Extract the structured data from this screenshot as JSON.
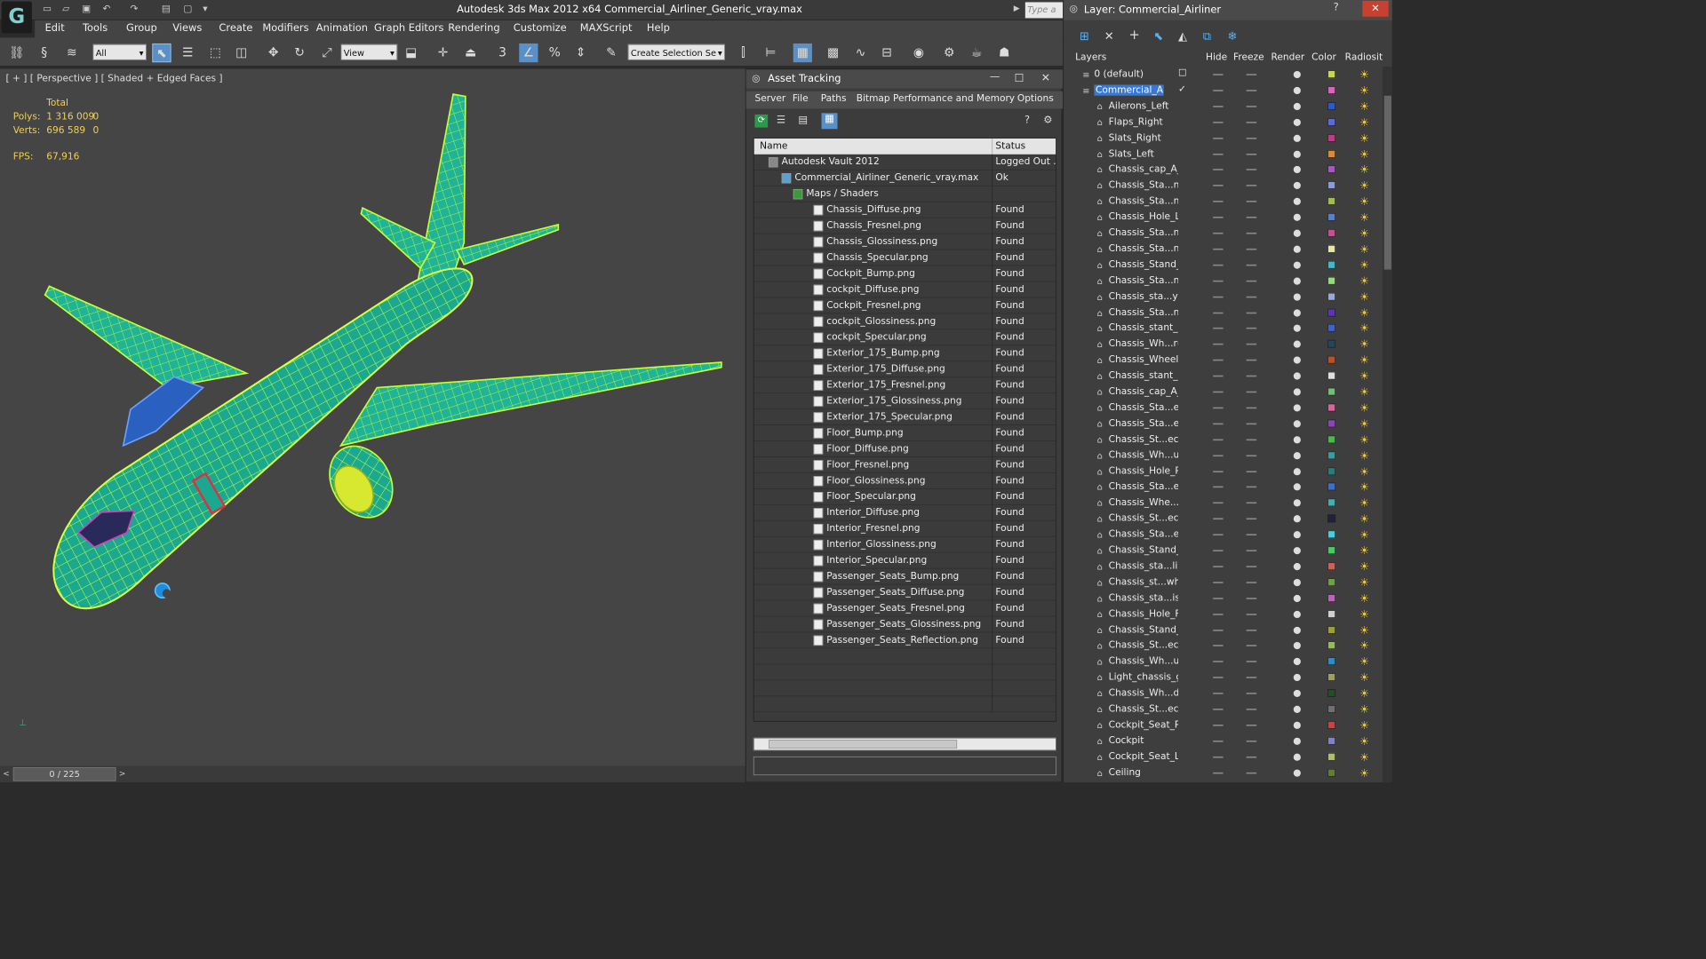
{
  "window": {
    "title": "Autodesk 3ds Max  2012 x64     Commercial_Airliner_Generic_vray.max",
    "search_placeholder": "Type a"
  },
  "menubar": [
    "Edit",
    "Tools",
    "Group",
    "Views",
    "Create",
    "Modifiers",
    "Animation",
    "Graph Editors",
    "Rendering",
    "Customize",
    "MAXScript",
    "Help"
  ],
  "toolbar": {
    "filter_value": "All",
    "refcoord_value": "View",
    "selection_set_placeholder": "Create Selection Se"
  },
  "viewport": {
    "label": "[ + ] [ Perspective ] [ Shaded + Edged Faces ]",
    "stats_header": "Total",
    "polys_label": "Polys:",
    "polys_value": "1 316 009",
    "polys_sel": "0",
    "verts_label": "Verts:",
    "verts_value": "696 589",
    "verts_sel": "0",
    "fps_label": "FPS:",
    "fps_value": "67,916"
  },
  "timeline": {
    "frame": "0 / 225"
  },
  "asset_tracking": {
    "title": "Asset Tracking",
    "menu": [
      "Server",
      "File",
      "Paths",
      "Bitmap Performance and Memory",
      "Options"
    ],
    "col_name": "Name",
    "col_status": "Status",
    "rows": [
      {
        "name": "Autodesk Vault 2012",
        "status": "Logged Out ..."
      },
      {
        "name": "Commercial_Airliner_Generic_vray.max",
        "status": "Ok"
      },
      {
        "name": "Maps / Shaders",
        "status": ""
      },
      {
        "name": "Chassis_Diffuse.png",
        "status": "Found"
      },
      {
        "name": "Chassis_Fresnel.png",
        "status": "Found"
      },
      {
        "name": "Chassis_Glossiness.png",
        "status": "Found"
      },
      {
        "name": "Chassis_Specular.png",
        "status": "Found"
      },
      {
        "name": "Cockpit_Bump.png",
        "status": "Found"
      },
      {
        "name": "cockpit_Diffuse.png",
        "status": "Found"
      },
      {
        "name": "Cockpit_Fresnel.png",
        "status": "Found"
      },
      {
        "name": "cockpit_Glossiness.png",
        "status": "Found"
      },
      {
        "name": "cockpit_Specular.png",
        "status": "Found"
      },
      {
        "name": "Exterior_175_Bump.png",
        "status": "Found"
      },
      {
        "name": "Exterior_175_Diffuse.png",
        "status": "Found"
      },
      {
        "name": "Exterior_175_Fresnel.png",
        "status": "Found"
      },
      {
        "name": "Exterior_175_Glossiness.png",
        "status": "Found"
      },
      {
        "name": "Exterior_175_Specular.png",
        "status": "Found"
      },
      {
        "name": "Floor_Bump.png",
        "status": "Found"
      },
      {
        "name": "Floor_Diffuse.png",
        "status": "Found"
      },
      {
        "name": "Floor_Fresnel.png",
        "status": "Found"
      },
      {
        "name": "Floor_Glossiness.png",
        "status": "Found"
      },
      {
        "name": "Floor_Specular.png",
        "status": "Found"
      },
      {
        "name": "Interior_Diffuse.png",
        "status": "Found"
      },
      {
        "name": "Interior_Fresnel.png",
        "status": "Found"
      },
      {
        "name": "Interior_Glossiness.png",
        "status": "Found"
      },
      {
        "name": "Interior_Specular.png",
        "status": "Found"
      },
      {
        "name": "Passenger_Seats_Bump.png",
        "status": "Found"
      },
      {
        "name": "Passenger_Seats_Diffuse.png",
        "status": "Found"
      },
      {
        "name": "Passenger_Seats_Fresnel.png",
        "status": "Found"
      },
      {
        "name": "Passenger_Seats_Glossiness.png",
        "status": "Found"
      },
      {
        "name": "Passenger_Seats_Reflection.png",
        "status": "Found"
      }
    ]
  },
  "layers_panel": {
    "title": "Layer: Commercial_Airliner",
    "cols": [
      "Layers",
      "Hide",
      "Freeze",
      "Render",
      "Color",
      "Radiosit"
    ],
    "rows": [
      {
        "name": "0 (default)",
        "color": "#c8d84a"
      },
      {
        "name": "Commercial_Airliner",
        "color": "#e060c0"
      },
      {
        "name": "Ailerons_Left",
        "color": "#2a5ad0"
      },
      {
        "name": "Flaps_Right",
        "color": "#5a6ae0"
      },
      {
        "name": "Slats_Right",
        "color": "#c03a8a"
      },
      {
        "name": "Slats_Left",
        "color": "#e08a30"
      },
      {
        "name": "Chassis_cap_A_l",
        "color": "#b050d0"
      },
      {
        "name": "Chassis_Sta...ne",
        "color": "#8a9ae0"
      },
      {
        "name": "Chassis_Sta...ne",
        "color": "#a0c040"
      },
      {
        "name": "Chassis_Hole_Le",
        "color": "#5080d8"
      },
      {
        "name": "Chassis_Sta...ne",
        "color": "#d04a90"
      },
      {
        "name": "Chassis_Sta...ne",
        "color": "#e8e8a0"
      },
      {
        "name": "Chassis_Stand_l",
        "color": "#30c0d0"
      },
      {
        "name": "Chassis_Sta...ne",
        "color": "#90e070"
      },
      {
        "name": "Chassis_sta...yli",
        "color": "#9aa8e0"
      },
      {
        "name": "Chassis_Sta...ne",
        "color": "#6030c0"
      },
      {
        "name": "Chassis_stant_w",
        "color": "#4060d0"
      },
      {
        "name": "Chassis_Wh...ru",
        "color": "#204858"
      },
      {
        "name": "Chassis_Wheels_",
        "color": "#c05020"
      },
      {
        "name": "Chassis_stant_p",
        "color": "#e0e0e0"
      },
      {
        "name": "Chassis_cap_A_r",
        "color": "#70c070"
      },
      {
        "name": "Chassis_Sta...ec",
        "color": "#e060a0"
      },
      {
        "name": "Chassis_Sta...ec",
        "color": "#9040c0"
      },
      {
        "name": "Chassis_St...ect",
        "color": "#40c040"
      },
      {
        "name": "Chassis_Wh...ub",
        "color": "#30a0a0"
      },
      {
        "name": "Chassis_Hole_Ri",
        "color": "#208080"
      },
      {
        "name": "Chassis_Sta...ec",
        "color": "#3a70d0"
      },
      {
        "name": "Chassis_Whe...c",
        "color": "#40b0b0"
      },
      {
        "name": "Chassis_St...ect",
        "color": "#202040"
      },
      {
        "name": "Chassis_Sta...ec",
        "color": "#40d0e0"
      },
      {
        "name": "Chassis_Stand_r",
        "color": "#40d060"
      },
      {
        "name": "Chassis_sta...lin",
        "color": "#d06050"
      },
      {
        "name": "Chassis_st...whe",
        "color": "#70a040"
      },
      {
        "name": "Chassis_sta...ist",
        "color": "#c060c0"
      },
      {
        "name": "Chassis_Hole_Fr",
        "color": "#d0d0d0"
      },
      {
        "name": "Chassis_Stand_f",
        "color": "#a0a030"
      },
      {
        "name": "Chassis_St...ect",
        "color": "#90c050"
      },
      {
        "name": "Chassis_Wh...ub",
        "color": "#2090d0"
      },
      {
        "name": "Light_chassis_gl",
        "color": "#a0a050"
      },
      {
        "name": "Chassis_Wh...di",
        "color": "#205020"
      },
      {
        "name": "Chassis_St...ect",
        "color": "#707070"
      },
      {
        "name": "Cockpit_Seat_Ri",
        "color": "#d04040"
      },
      {
        "name": "Cockpit",
        "color": "#8080d0"
      },
      {
        "name": "Cockpit_Seat_Le",
        "color": "#b0c060"
      },
      {
        "name": "Ceiling",
        "color": "#608030"
      }
    ]
  }
}
